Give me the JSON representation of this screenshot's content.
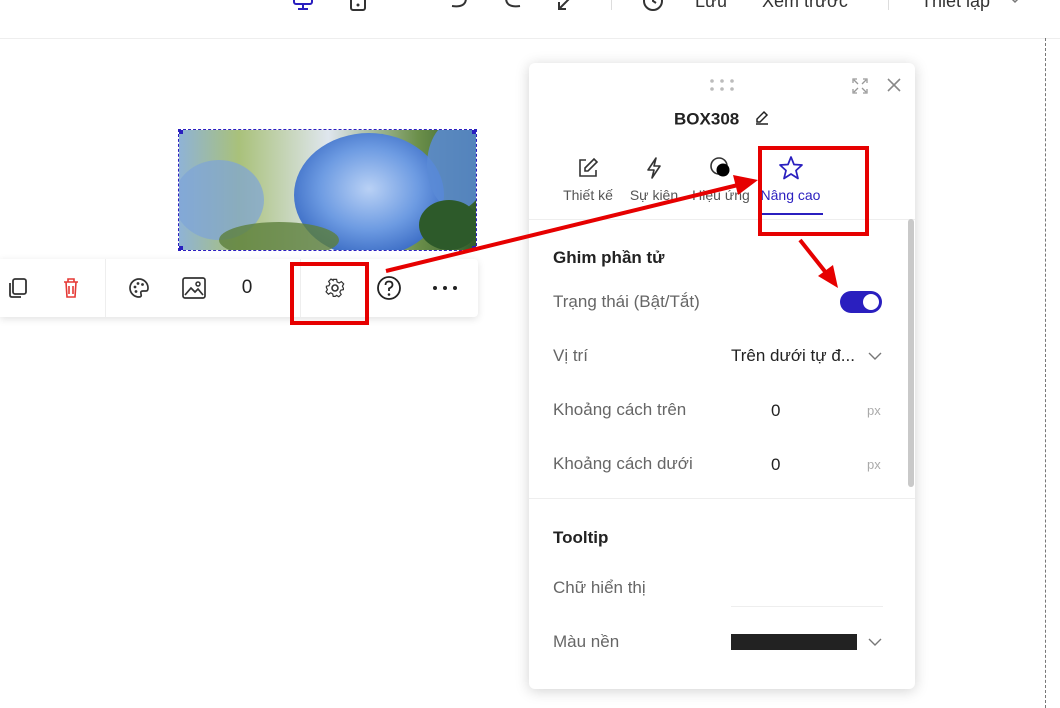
{
  "header": {
    "save_label": "Lưu",
    "preview_label": "Xem trước",
    "settings_label": "Thiết lập"
  },
  "toolbar": {
    "counter_value": "0"
  },
  "panel": {
    "title": "BOX308",
    "tabs": [
      {
        "label": "Thiết kế",
        "icon": "edit-icon"
      },
      {
        "label": "Sự kiện",
        "icon": "lightning-icon"
      },
      {
        "label": "Hiệu ứng",
        "icon": "effect-icon"
      },
      {
        "label": "Nâng cao",
        "icon": "star-icon",
        "active": true
      }
    ],
    "pin_section": {
      "title": "Ghim phần tử",
      "status_label": "Trạng thái (Bật/Tắt)",
      "status_on": true,
      "position_label": "Vị trí",
      "position_value": "Trên dưới tự đ...",
      "top_spacing_label": "Khoảng cách trên",
      "top_spacing_value": "0",
      "bottom_spacing_label": "Khoảng cách dưới",
      "bottom_spacing_value": "0",
      "unit": "px"
    },
    "tooltip_section": {
      "title": "Tooltip",
      "display_text_label": "Chữ hiển thị",
      "display_text_value": "",
      "background_label": "Màu nền",
      "background_color": "#222222"
    }
  },
  "colors": {
    "accent": "#2a1fbf",
    "annotation": "#e60000",
    "delete": "#e53935"
  }
}
